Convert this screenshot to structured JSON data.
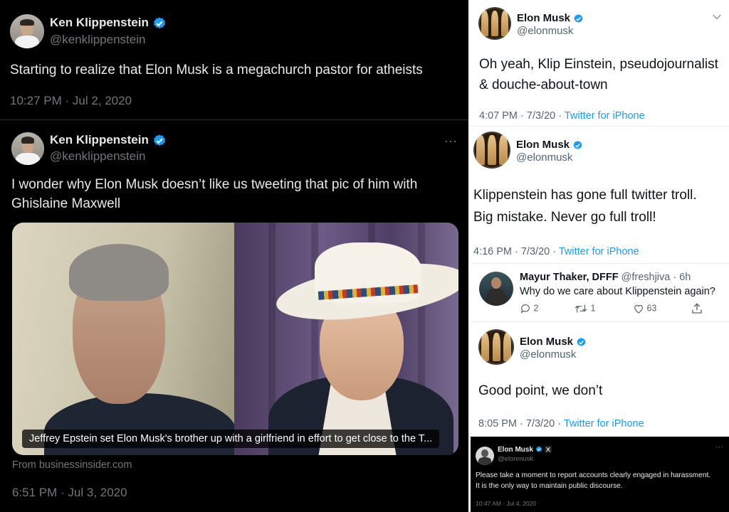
{
  "left": {
    "tweet1": {
      "name": "Ken Klippenstein",
      "handle": "@kenklippenstein",
      "text": "Starting to realize that Elon Musk is a megachurch pastor for atheists",
      "timestamp": "10:27 PM · Jul 2, 2020"
    },
    "tweet2": {
      "name": "Ken Klippenstein",
      "handle": "@kenklippenstein",
      "more": "···",
      "text_line1": "I wonder why Elon Musk doesn’t like us tweeting that pic of him with",
      "text_line2": "Ghislaine Maxwell",
      "card_caption": "Jeffrey Epstein set Elon Musk's brother up with a girlfriend in effort to get close to the T...",
      "card_source": "From businessinsider.com",
      "timestamp": "6:51 PM · Jul 3, 2020"
    }
  },
  "right": {
    "reply1": {
      "name": "Elon Musk",
      "handle": "@elonmusk",
      "text_line1": "Oh yeah, Klip Einstein, pseudojournalist",
      "text_line2": "& douche-about-town",
      "time": "4:07 PM · 7/3/20 · ",
      "client": "Twitter for iPhone"
    },
    "reply2": {
      "name": "Elon Musk",
      "handle": "@elonmusk",
      "text_line1": "Klippenstein has gone full twitter troll.",
      "text_line2": "Big mistake. Never go full troll!",
      "time": "4:16 PM · 7/3/20 · ",
      "client": "Twitter for iPhone"
    },
    "mayur": {
      "name": "Mayur Thaker, DFFF",
      "handle": "@freshjiva · 6h",
      "text": "Why do we care about Klippenstein again?",
      "replies": "2",
      "retweets": "1",
      "likes": "63"
    },
    "reply3": {
      "name": "Elon Musk",
      "handle": "@elonmusk",
      "text": "Good point, we don’t",
      "time": "8:05 PM · 7/3/20 · ",
      "client": "Twitter for iPhone"
    },
    "bottom": {
      "name": "Elon Musk",
      "handle": "@elonmusk",
      "more": "···",
      "text_line1": "Please take a moment to report accounts clearly engaged in harassment.",
      "text_line2": "It is the only way to maintain public discourse.",
      "timestamp": "10:47 AM · Jul 4, 2020"
    }
  },
  "colors": {
    "verified": "#1d9bf0",
    "link": "#1d9bf0",
    "dark_bg": "#000000"
  },
  "icons": [
    "verified-badge-icon",
    "more-icon",
    "reply-icon",
    "retweet-icon",
    "like-icon",
    "share-icon",
    "x-logo-icon"
  ]
}
